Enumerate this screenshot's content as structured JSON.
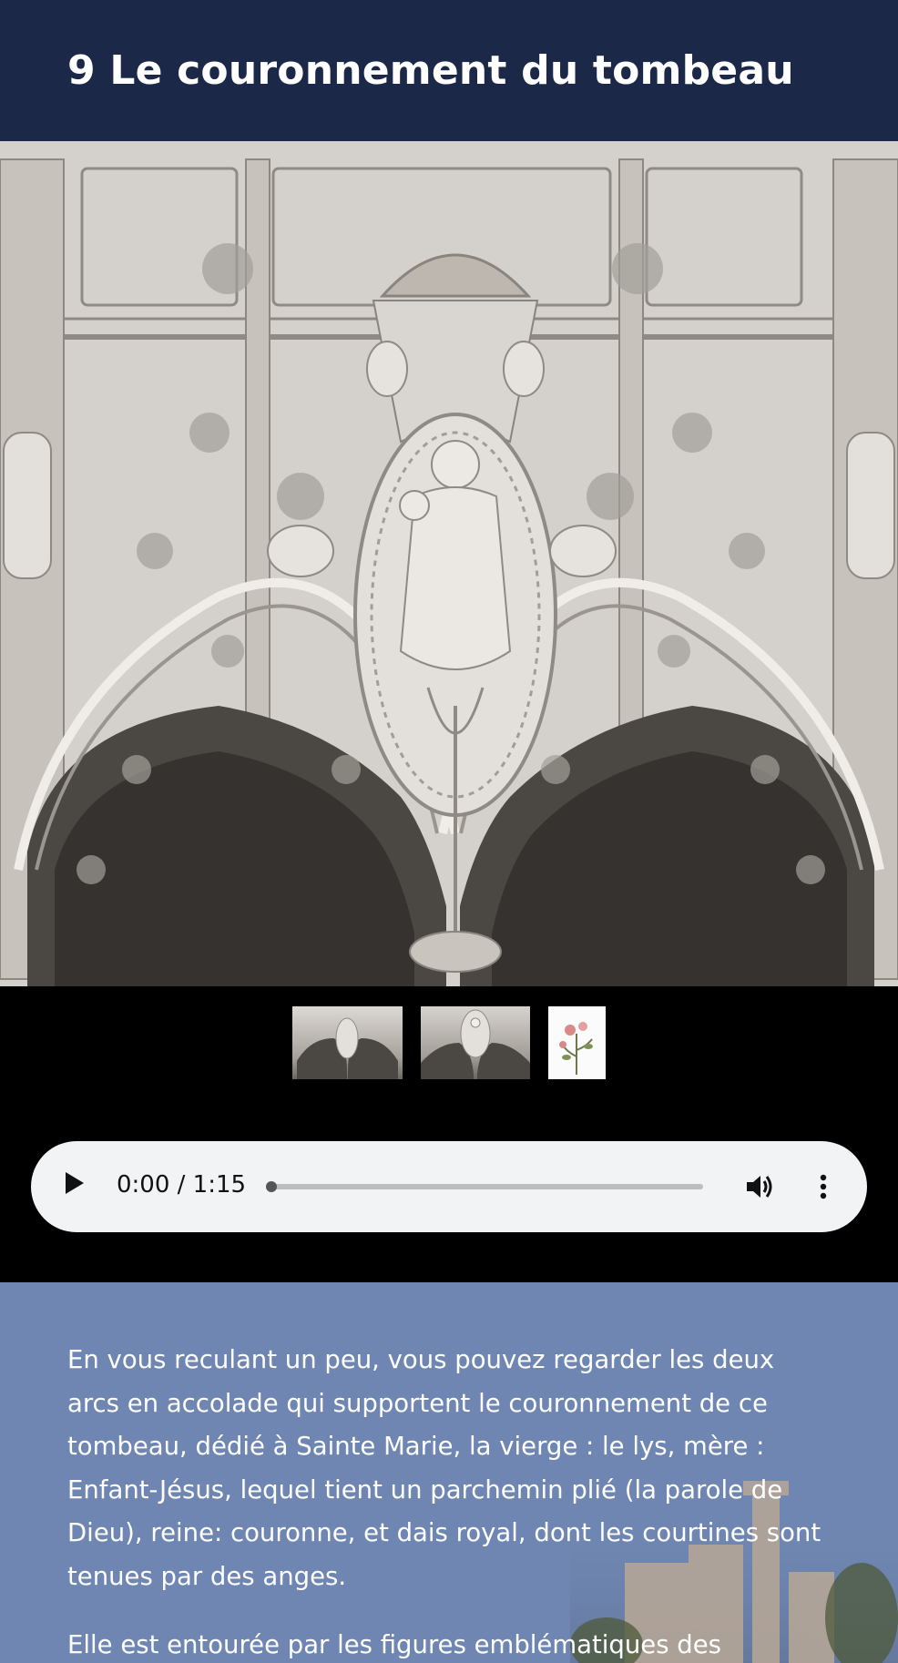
{
  "header": {
    "title": "9 Le couronnement du tombeau"
  },
  "hero": {
    "image": "carved-tomb-crowning-photo"
  },
  "thumbnails": [
    {
      "name": "tomb-arches-thumbnail"
    },
    {
      "name": "tomb-virgin-thumbnail"
    },
    {
      "name": "rose-illustration-thumbnail"
    }
  ],
  "audio": {
    "time": "0:00 / 1:15",
    "progress": 0
  },
  "content": {
    "p1": "En vous reculant un peu, vous pouvez regarder les deux arcs en accolade qui supportent le couronnement de ce tombeau, dédié à Sainte Marie, la vierge : le lys, mère : Enfant-Jésus, lequel tient un parchemin plié (la parole de Dieu), reine: couronne, et dais royal, dont les courtines sont tenues par des anges.",
    "p2": "Elle est entourée par les figures emblématiques des"
  },
  "colors": {
    "header": "#1b2848",
    "content": "#6e86b1",
    "player": "#f1f3f4"
  }
}
